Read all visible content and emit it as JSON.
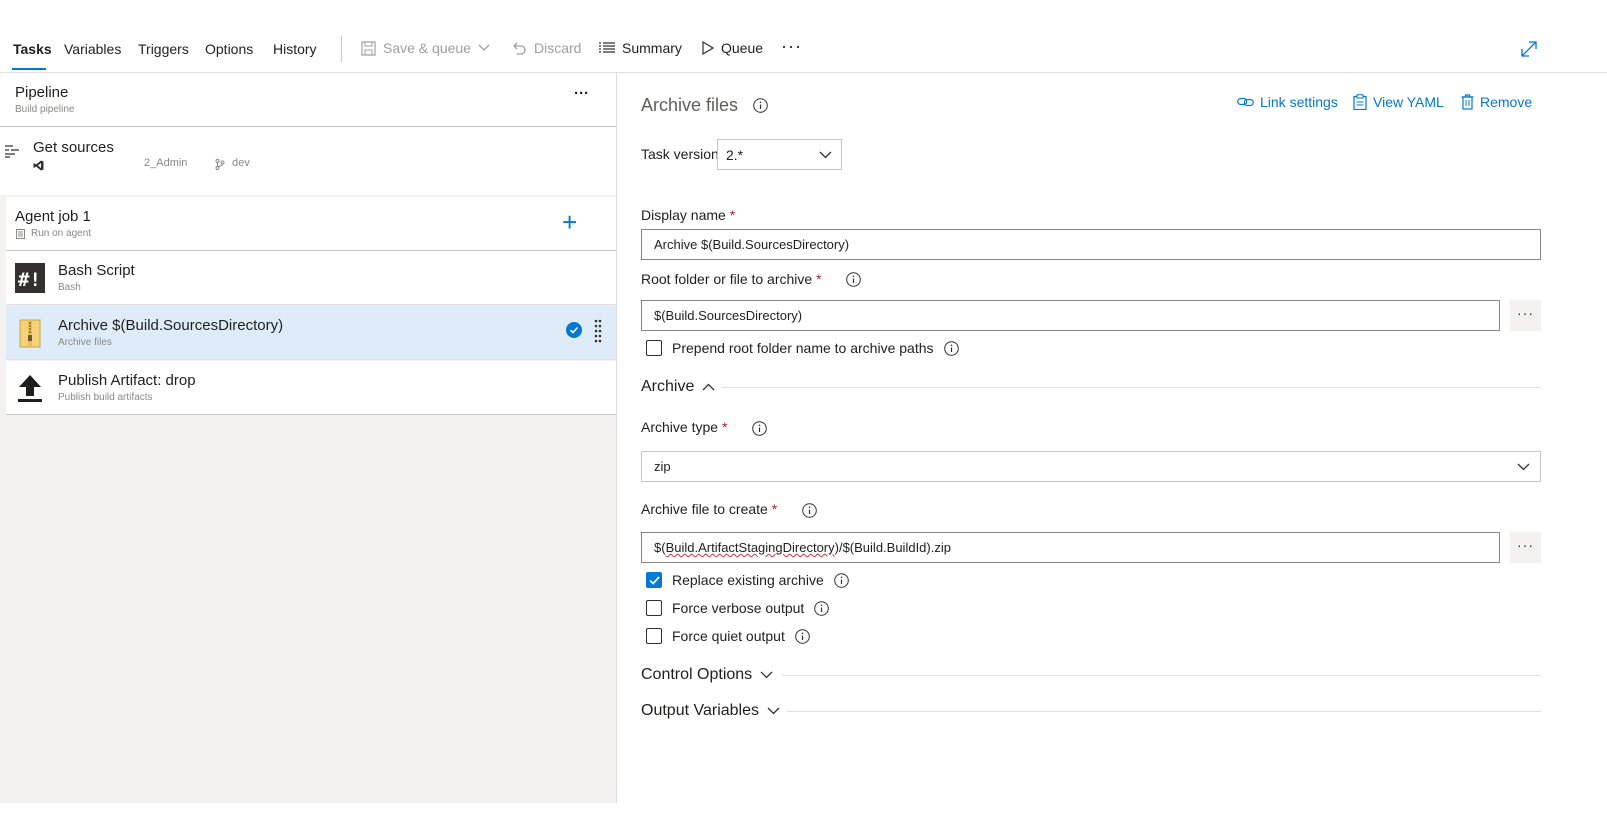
{
  "tabs": [
    "Tasks",
    "Variables",
    "Triggers",
    "Options",
    "History"
  ],
  "toolbar": {
    "save_queue": "Save & queue",
    "discard": "Discard",
    "summary": "Summary",
    "queue": "Queue",
    "more": "···"
  },
  "pipeline": {
    "title": "Pipeline",
    "subtitle": "Build pipeline",
    "more": "···"
  },
  "get_sources": {
    "title": "Get sources",
    "repo": "2_Admin",
    "branch": "dev"
  },
  "agent_job": {
    "title": "Agent job 1",
    "subtitle": "Run on agent",
    "add": "+"
  },
  "tasks": [
    {
      "title": "Bash Script",
      "subtitle": "Bash",
      "icon": "bash-icon"
    },
    {
      "title": "Archive $(Build.SourcesDirectory)",
      "subtitle": "Archive files",
      "icon": "archive-icon",
      "selected": true
    },
    {
      "title": "Publish Artifact: drop",
      "subtitle": "Publish build artifacts",
      "icon": "publish-icon"
    }
  ],
  "detail": {
    "title": "Archive files",
    "actions": {
      "link_settings": "Link settings",
      "view_yaml": "View YAML",
      "remove": "Remove"
    },
    "task_version_label": "Task version",
    "task_version_value": "2.*",
    "display_name_label": "Display name",
    "display_name_value": "Archive $(Build.SourcesDirectory)",
    "root_folder_label": "Root folder or file to archive",
    "root_folder_value": "$(Build.SourcesDirectory)",
    "prepend_label": "Prepend root folder name to archive paths",
    "archive_section": "Archive",
    "archive_type_label": "Archive type",
    "archive_type_value": "zip",
    "archive_file_label": "Archive file to create",
    "archive_file_value_a": "$(",
    "archive_file_value_b": "Build.ArtifactStagingDirectory",
    "archive_file_value_c": ")/$(Build.BuildId).zip",
    "replace_label": "Replace existing archive",
    "verbose_label": "Force verbose output",
    "quiet_label": "Force quiet output",
    "control_options": "Control Options",
    "output_variables": "Output Variables",
    "required_mark": "*",
    "more": "···"
  },
  "colors": {
    "accent": "#0078d4",
    "selected_row": "#deecf9",
    "required": "#a4262c"
  }
}
